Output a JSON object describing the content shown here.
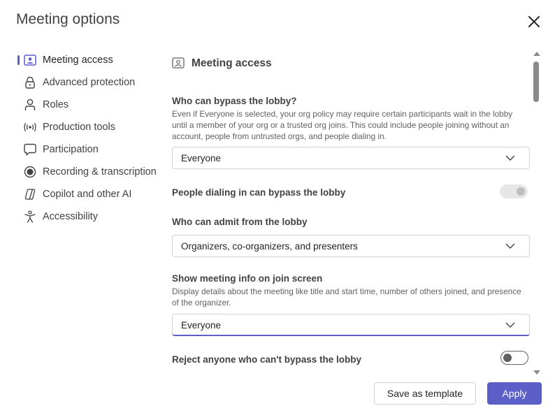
{
  "dialog": {
    "title": "Meeting options"
  },
  "nav": {
    "items": [
      {
        "label": "Meeting access",
        "icon": "meeting-access-icon",
        "active": true
      },
      {
        "label": "Advanced protection",
        "icon": "lock-icon"
      },
      {
        "label": "Roles",
        "icon": "person-icon"
      },
      {
        "label": "Production tools",
        "icon": "broadcast-icon"
      },
      {
        "label": "Participation",
        "icon": "chat-icon"
      },
      {
        "label": "Recording & transcription",
        "icon": "record-icon"
      },
      {
        "label": "Copilot and other AI",
        "icon": "copilot-icon"
      },
      {
        "label": "Accessibility",
        "icon": "accessibility-icon"
      }
    ]
  },
  "section": {
    "title": "Meeting access",
    "bypass": {
      "title": "Who can bypass the lobby?",
      "desc": "Even if Everyone is selected, your org policy may require certain participants wait in the lobby until a member of your org or a trusted org joins. This could include people joining without an account, people from untrusted orgs, and people dialing in.",
      "value": "Everyone"
    },
    "dialin": {
      "title": "People dialing in can bypass the lobby",
      "state": "disabled-on"
    },
    "admit": {
      "title": "Who can admit from the lobby",
      "value": "Organizers, co-organizers, and presenters"
    },
    "info": {
      "title": "Show meeting info on join screen",
      "desc": "Display details about the meeting like title and start time, number of others joined, and presence of the organizer.",
      "value": "Everyone"
    },
    "reject": {
      "title": "Reject anyone who can't bypass the lobby",
      "state": "off"
    }
  },
  "footer": {
    "save_template": "Save as template",
    "apply": "Apply"
  },
  "colors": {
    "accent": "#5b5fc7",
    "text": "#242424",
    "muted": "#616161"
  }
}
